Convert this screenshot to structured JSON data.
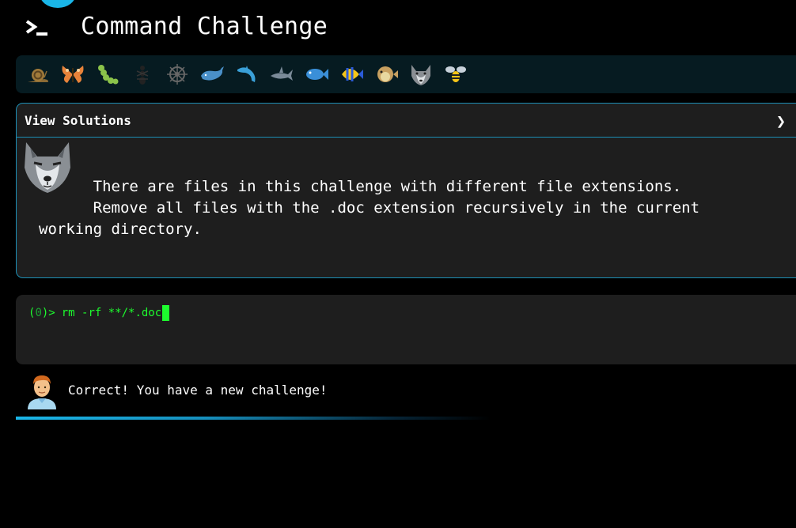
{
  "app": {
    "title": "Command Challenge",
    "accent_color": "#1ab6e8"
  },
  "levels": [
    {
      "name": "snail-icon"
    },
    {
      "name": "butterfly-icon"
    },
    {
      "name": "bug-icon"
    },
    {
      "name": "ant-icon"
    },
    {
      "name": "ship-wheel-icon"
    },
    {
      "name": "whale-icon"
    },
    {
      "name": "dolphin-icon"
    },
    {
      "name": "shark-icon"
    },
    {
      "name": "fish-icon"
    },
    {
      "name": "tropical-fish-icon"
    },
    {
      "name": "pufferfish-icon"
    },
    {
      "name": "wolf-icon"
    },
    {
      "name": "bee-icon"
    }
  ],
  "solutions": {
    "title": "View Solutions",
    "chevron": "❯"
  },
  "challenge": {
    "description": "      There are files in this challenge with different file extensions.\n      Remove all files with the .doc extension recursively in the current\nworking directory."
  },
  "terminal": {
    "prompt_open": "(",
    "prompt_code": "0",
    "prompt_close": ")>",
    "command": "rm -rf **/*.doc",
    "text_color": "#1dfc2e"
  },
  "feedback": {
    "message": "Correct! You have a new challenge!",
    "progress": 0.6
  }
}
